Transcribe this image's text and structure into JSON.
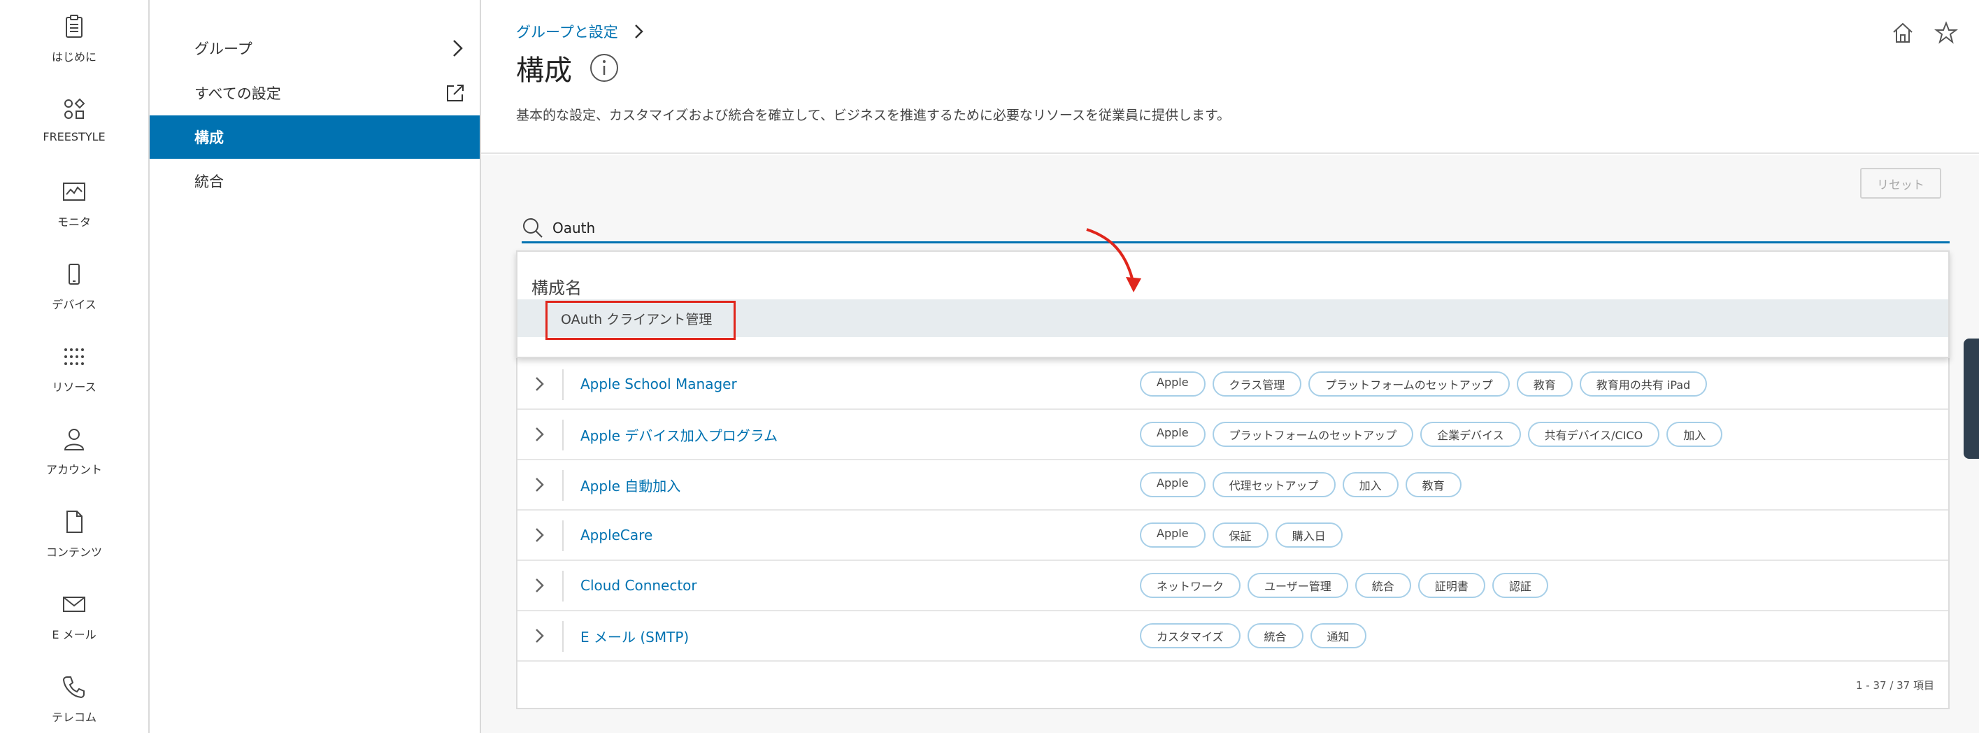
{
  "rail": {
    "items": [
      {
        "label": "はじめに",
        "icon": "clipboard-icon"
      },
      {
        "label": "FREESTYLE",
        "icon": "freestyle-icon"
      },
      {
        "label": "モニタ",
        "icon": "monitor-icon"
      },
      {
        "label": "デバイス",
        "icon": "phone-icon"
      },
      {
        "label": "リソース",
        "icon": "grid-icon"
      },
      {
        "label": "アカウント",
        "icon": "person-icon"
      },
      {
        "label": "コンテンツ",
        "icon": "document-icon"
      },
      {
        "label": "E メール",
        "icon": "mail-icon"
      },
      {
        "label": "テレコム",
        "icon": "phone-handset-icon"
      }
    ]
  },
  "sidebar": {
    "items": [
      {
        "label": "グループ"
      },
      {
        "label": "すべての設定"
      },
      {
        "label": "構成"
      },
      {
        "label": "統合"
      }
    ]
  },
  "header": {
    "breadcrumb": "グループと設定",
    "title": "構成",
    "description": "基本的な設定、カスタマイズおよび統合を確立して、ビジネスを推進するために必要なリソースを従業員に提供します。"
  },
  "toolbar": {
    "reset_label": "リセット"
  },
  "search": {
    "value": "Oauth"
  },
  "dropdown": {
    "header": "構成名",
    "items": [
      {
        "label": "OAuth クライアント管理"
      }
    ]
  },
  "table": {
    "rows": [
      {
        "name": "Apple School Manager",
        "tags": [
          "Apple",
          "クラス管理",
          "プラットフォームのセットアップ",
          "教育",
          "教育用の共有 iPad"
        ]
      },
      {
        "name": "Apple デバイス加入プログラム",
        "tags": [
          "Apple",
          "プラットフォームのセットアップ",
          "企業デバイス",
          "共有デバイス/CICO",
          "加入"
        ]
      },
      {
        "name": "Apple 自動加入",
        "tags": [
          "Apple",
          "代理セットアップ",
          "加入",
          "教育"
        ]
      },
      {
        "name": "AppleCare",
        "tags": [
          "Apple",
          "保証",
          "購入日"
        ]
      },
      {
        "name": "Cloud Connector",
        "tags": [
          "ネットワーク",
          "ユーザー管理",
          "統合",
          "証明書",
          "認証"
        ]
      },
      {
        "name": "E メール (SMTP)",
        "tags": [
          "カスタマイズ",
          "統合",
          "通知"
        ]
      }
    ],
    "count": "1 - 37 / 37 項目"
  },
  "colors": {
    "accent": "#0072b1",
    "highlight": "#e0251b"
  }
}
